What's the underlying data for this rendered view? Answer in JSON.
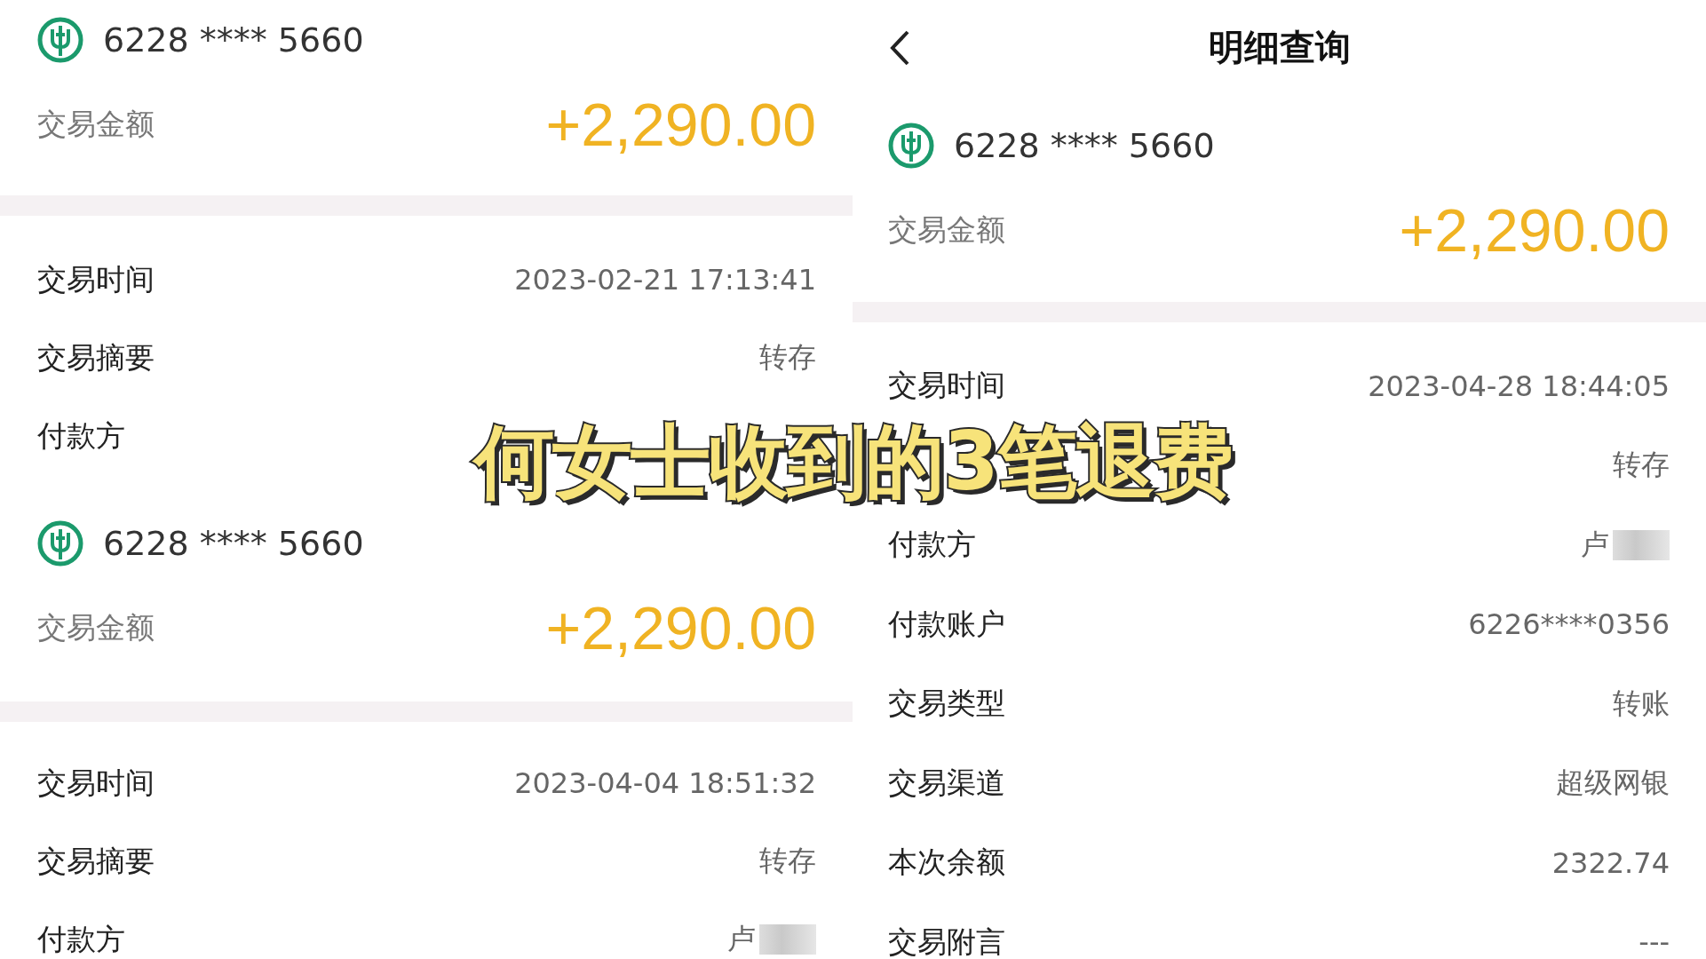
{
  "left_panel": {
    "cards": [
      {
        "account": "6228 **** 5660",
        "amount_label": "交易金额",
        "amount": "+2,290.00",
        "rows": [
          {
            "label": "交易时间",
            "value": "2023-02-21 17:13:41"
          },
          {
            "label": "交易摘要",
            "value": "转存"
          },
          {
            "label": "付款方"
          }
        ]
      },
      {
        "account": "6228 **** 5660",
        "amount_label": "交易金额",
        "amount": "+2,290.00",
        "rows": [
          {
            "label": "交易时间",
            "value": "2023-04-04 18:51:32"
          },
          {
            "label": "交易摘要",
            "value": "转存"
          },
          {
            "label": "付款方",
            "value": "卢",
            "blurred": true
          }
        ]
      }
    ]
  },
  "right_panel": {
    "title": "明细查询",
    "account": "6228 **** 5660",
    "amount_label": "交易金额",
    "amount": "+2,290.00",
    "rows": [
      {
        "label": "交易时间",
        "value": "2023-04-28 18:44:05"
      },
      {
        "value": "转存"
      },
      {
        "label": "付款方",
        "value": "卢",
        "blurred": true
      },
      {
        "label": "付款账户",
        "value": "6226****0356"
      },
      {
        "label": "交易类型",
        "value": "转账"
      },
      {
        "label": "交易渠道",
        "value": "超级网银"
      },
      {
        "label": "本次余额",
        "value": "2322.74"
      },
      {
        "label": "交易附言",
        "value": "---"
      }
    ]
  },
  "caption": "何女士收到的3笔退费"
}
